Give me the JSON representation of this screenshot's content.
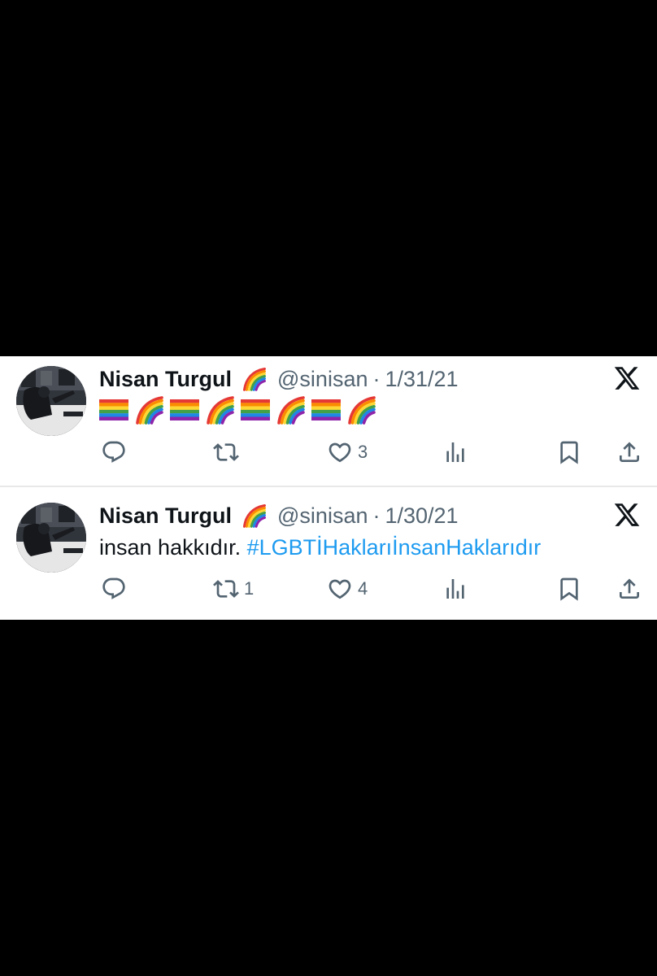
{
  "colors": {
    "background": "#000000",
    "card": "#ffffff",
    "name": "#0f1419",
    "secondary": "#536471",
    "hashtag": "#1d9bf0"
  },
  "tweets": [
    {
      "name": "Nisan Turgul",
      "name_badge": "rainbow-emoji",
      "handle": "@sinisan",
      "separator": "·",
      "date": "1/31/21",
      "body_emojis": [
        "rainbow-flag",
        "rainbow",
        "rainbow-flag",
        "rainbow",
        "rainbow-flag",
        "rainbow",
        "rainbow-flag",
        "rainbow"
      ],
      "replies": "",
      "retweets": "",
      "likes": "3"
    },
    {
      "name": "Nisan Turgul",
      "name_badge": "rainbow-emoji",
      "handle": "@sinisan",
      "separator": "·",
      "date": "1/30/21",
      "text": "insan hakkıdır.",
      "hashtag": "#LGBTİHaklarıİnsanHaklarıdır",
      "replies": "",
      "retweets": "1",
      "likes": "4"
    }
  ],
  "icons": [
    "x-logo-icon",
    "reply-icon",
    "retweet-icon",
    "like-icon",
    "views-icon",
    "bookmark-icon",
    "share-icon"
  ]
}
